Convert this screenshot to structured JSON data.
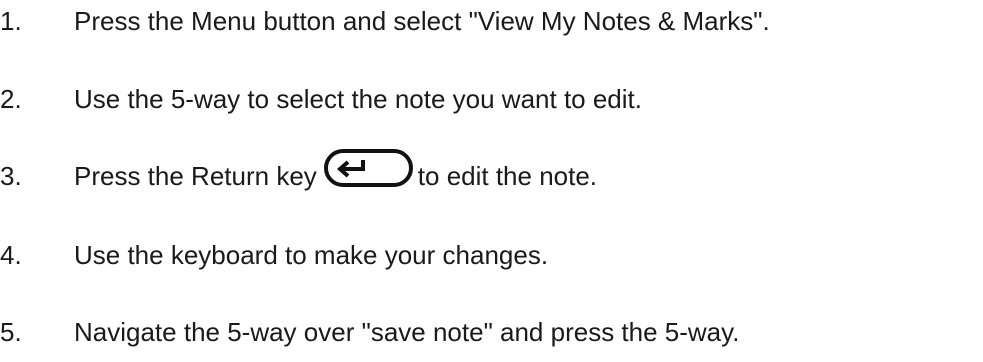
{
  "steps": [
    {
      "number": "1.",
      "text": "Press the Menu button and select \"View My Notes & Marks\"."
    },
    {
      "number": "2.",
      "text": "Use the 5-way to select the note you want to edit."
    },
    {
      "number": "3.",
      "text_before": "Press the Return key",
      "icon": "return-key-icon",
      "text_after": "to edit the note."
    },
    {
      "number": "4.",
      "text": "Use the keyboard to make your changes."
    },
    {
      "number": "5.",
      "text": "Navigate the 5-way over \"save note\" and press the 5-way."
    }
  ]
}
